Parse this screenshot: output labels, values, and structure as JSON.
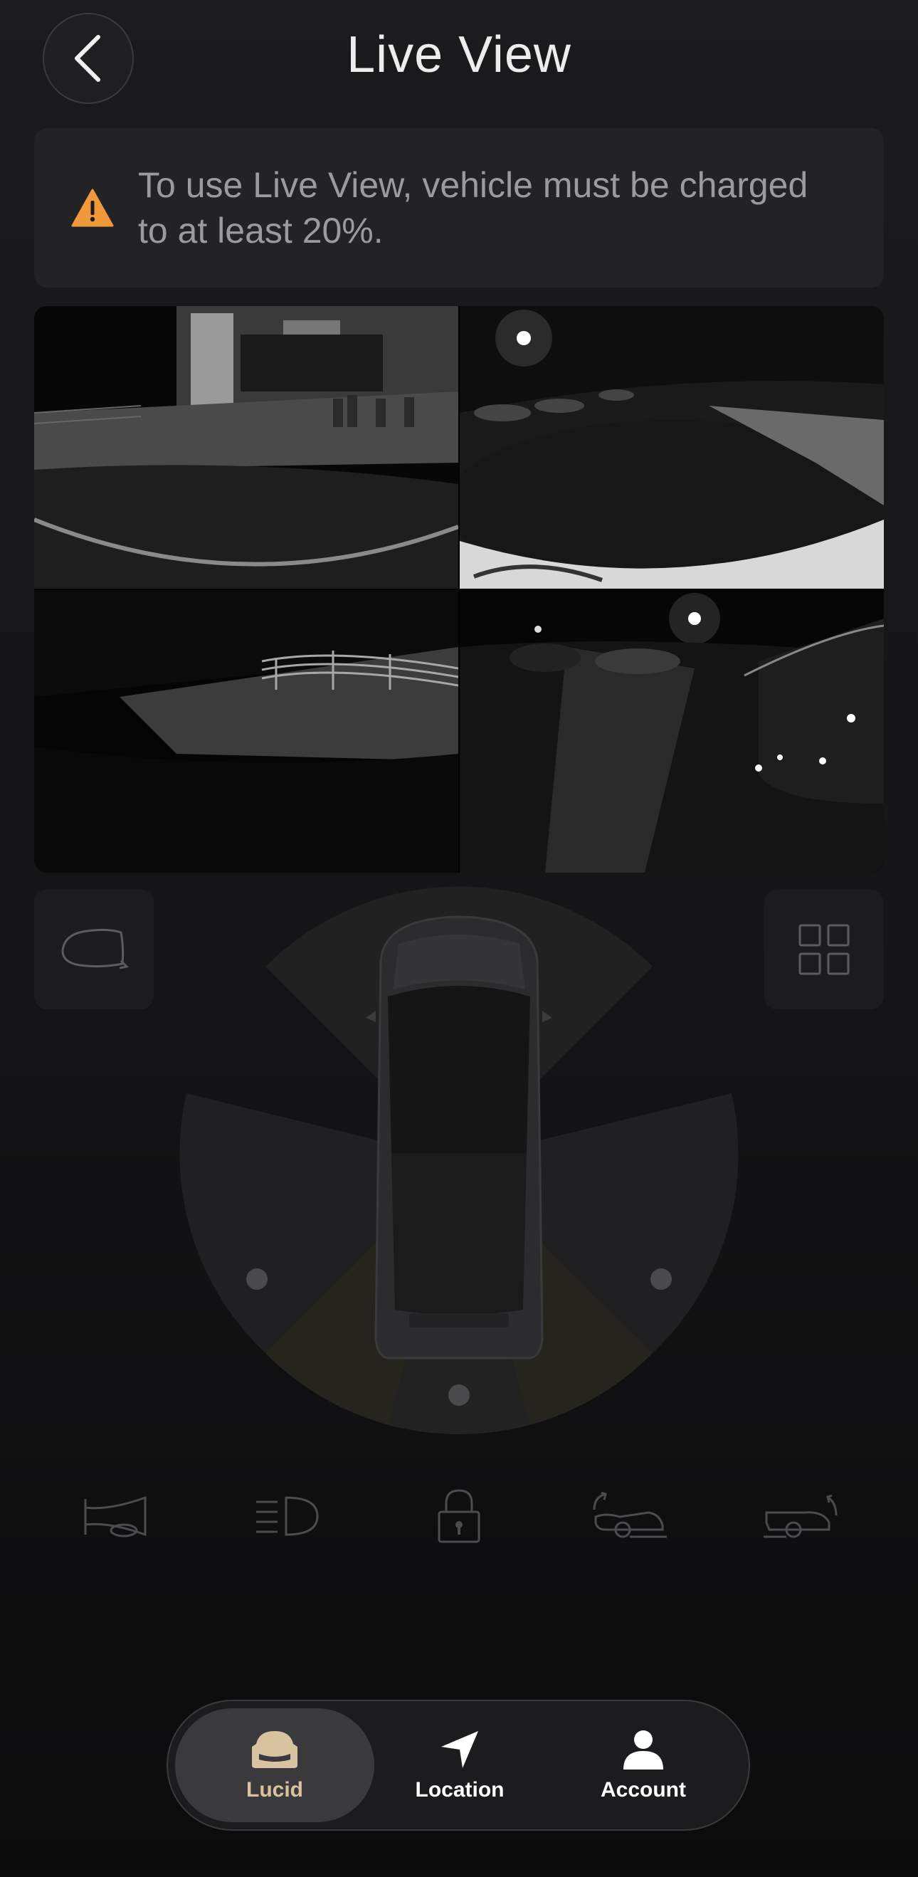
{
  "header": {
    "title": "Live View"
  },
  "banner": {
    "message": "To use Live View, vehicle must be charged to at least 20%."
  },
  "nav": {
    "items": [
      {
        "label": "Lucid",
        "active": true
      },
      {
        "label": "Location",
        "active": false
      },
      {
        "label": "Account",
        "active": false
      }
    ]
  },
  "colors": {
    "warning": "#f0993a",
    "accent": "#d8c3a0"
  },
  "icons": {
    "back": "chevron-left-icon",
    "warning": "warning-triangle-icon",
    "mirror": "side-mirror-icon",
    "grid": "grid-view-icon",
    "horn": "horn-icon",
    "headlights": "headlights-icon",
    "lock": "lock-icon",
    "frunk": "frunk-icon",
    "trunk": "trunk-icon",
    "car": "car-icon",
    "location": "location-arrow-icon",
    "account": "person-icon"
  }
}
